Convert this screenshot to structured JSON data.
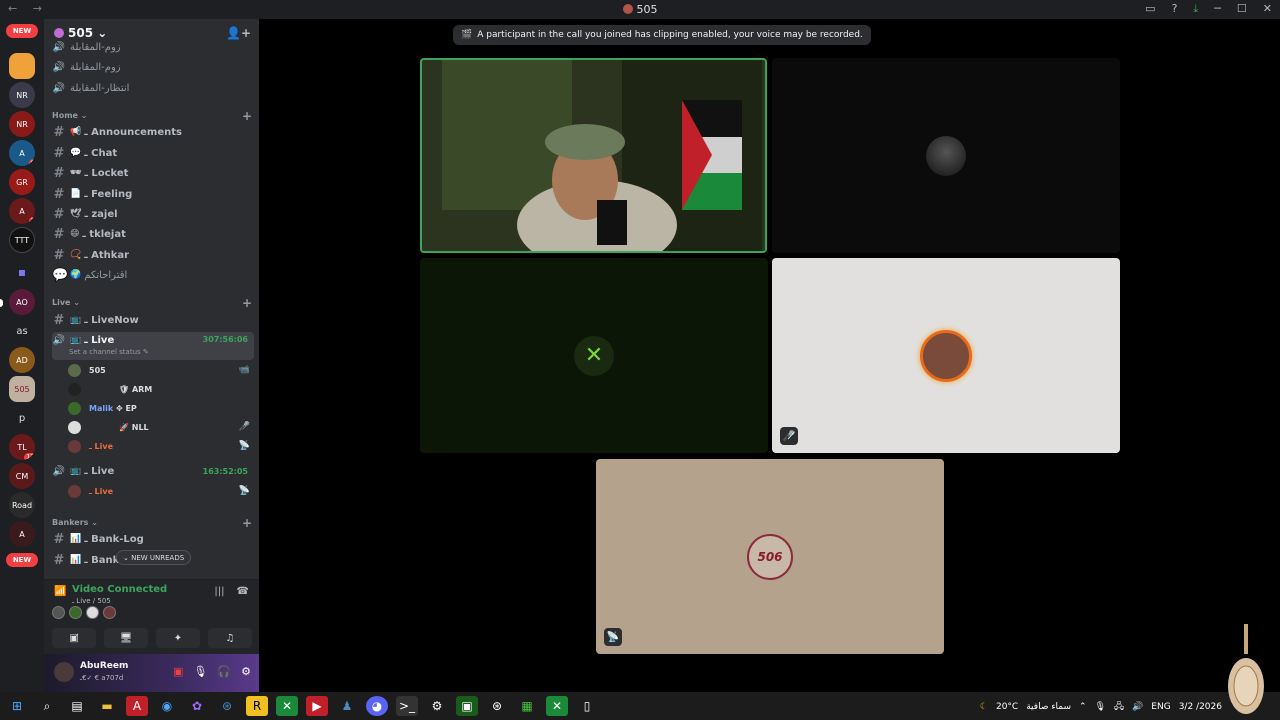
{
  "window": {
    "title": "505",
    "nav": [
      "←",
      "→"
    ],
    "controls": [
      "▭",
      "?",
      "⤓",
      "─",
      "☐",
      "✕"
    ]
  },
  "rail": {
    "new_label": "NEW",
    "badges": [
      "6",
      "3",
      "17"
    ],
    "letters": [
      "as",
      "p"
    ]
  },
  "server": {
    "name": "505 ⌄"
  },
  "voice_top": [
    {
      "label": "زوم-المقابلة"
    },
    {
      "label": "زوم-المقابلة"
    },
    {
      "label": "انتظار-المقابلة"
    }
  ],
  "categories": {
    "home": "Home ⌄",
    "live": "Live ⌄",
    "bankers": "Bankers ⌄"
  },
  "home_channels": [
    {
      "emoji": "📢",
      "label": "ـ Announcements"
    },
    {
      "emoji": "💬",
      "label": "ـ Chat"
    },
    {
      "emoji": "🕶",
      "label": "ـ Locket"
    },
    {
      "emoji": "📄",
      "label": "ـ Feeling"
    },
    {
      "emoji": "🕊",
      "label": "ـ zajel"
    },
    {
      "emoji": "😄",
      "label": "ـ tklejat"
    },
    {
      "emoji": "📿",
      "label": "ـ Athkar"
    },
    {
      "emoji": "🌍",
      "label": "اقتراحاتكم"
    }
  ],
  "live_channels": {
    "livenow": "ـ LiveNow",
    "live1": {
      "label": "ـ Live",
      "time": "307:56:06",
      "status": "Set a channel status ✎"
    },
    "live2": {
      "label": "ـ Live",
      "time": "163:52:05"
    }
  },
  "live1_users": [
    {
      "name": "505",
      "icon": "📹"
    },
    {
      "name": "🛡 ARM",
      "icon": ""
    },
    {
      "name": "Malik",
      "tag": "✥ EP",
      "icon": ""
    },
    {
      "name": "🚀 NLL",
      "icon": "🎤̸"
    },
    {
      "name": "ـ Live",
      "icon": "📡"
    }
  ],
  "live2_users": [
    {
      "name": "ـ Live",
      "icon": "📡"
    }
  ],
  "bankers_channels": [
    {
      "emoji": "📊",
      "label": "ـ Bank-Log"
    },
    {
      "emoji": "📊",
      "label": "ـ Bank"
    }
  ],
  "new_unreads": "⌄ NEW UNREADS",
  "voice_panel": {
    "status": "Video Connected",
    "channel": "ـ Live / 505"
  },
  "user_panel": {
    "name": "AbuReem",
    "tag": "ـ€✓ € a707d"
  },
  "toast": {
    "text": "A participant in the call you joined has clipping enabled, your voice may be recorded."
  },
  "tiles": {
    "tile5_label": "506"
  },
  "taskbar": {
    "temperature": "20°C",
    "weather": "سماء صافية",
    "lang": "ENG",
    "date": "3/2 /2026"
  },
  "colors": {
    "accent_green": "#3ba55d",
    "live_orange": "#ed6c3a",
    "danger_red": "#f23f43",
    "sidebar_bg": "#2b2d31",
    "rail_bg": "#1e1f22"
  }
}
